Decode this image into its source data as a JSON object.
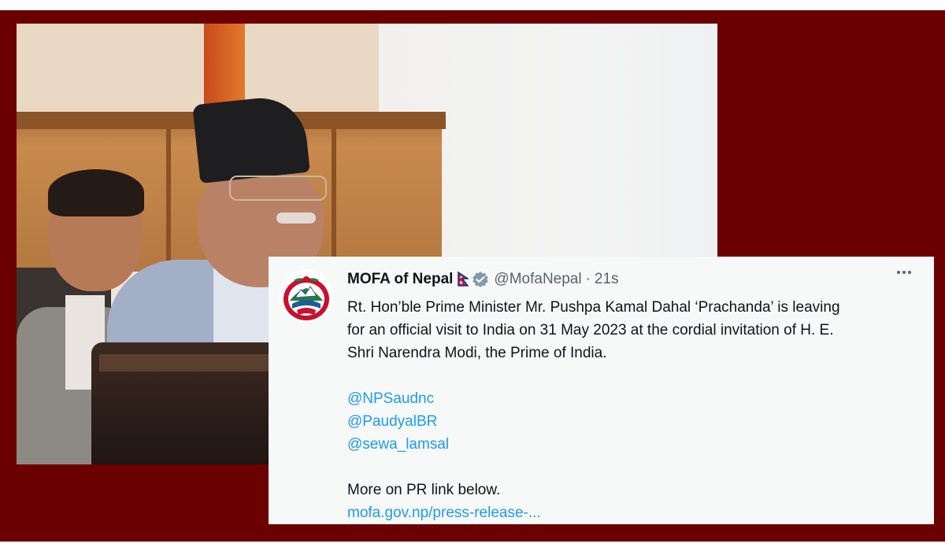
{
  "tweet": {
    "display_name": "MOFA of Nepal",
    "handle": "@MofaNepal",
    "separator": "·",
    "timestamp": "21s",
    "text_line1": "Rt. Hon’ble Prime Minister Mr. Pushpa Kamal Dahal ‘Prachanda’ is  leaving",
    "text_line2": "for an official visit to India on 31 May 2023 at the cordial invitation of H. E.",
    "text_line3": "Shri Narendra Modi, the Prime of India.",
    "mentions": [
      "@NPSaudnc",
      "@PaudyalBR",
      "@sewa_lamsal"
    ],
    "more_text": "More on PR link below.",
    "link_text": "mofa.gov.np/press-release-..."
  },
  "colors": {
    "frame": "#6b0000",
    "link": "#1d9bf0",
    "card_bg": "#f7f9f9",
    "verified": "#829aab"
  },
  "icons": {
    "avatar": "nepal-emblem-icon",
    "flag": "nepal-flag-icon",
    "verified": "verified-badge-icon",
    "more": "more-options-icon"
  }
}
